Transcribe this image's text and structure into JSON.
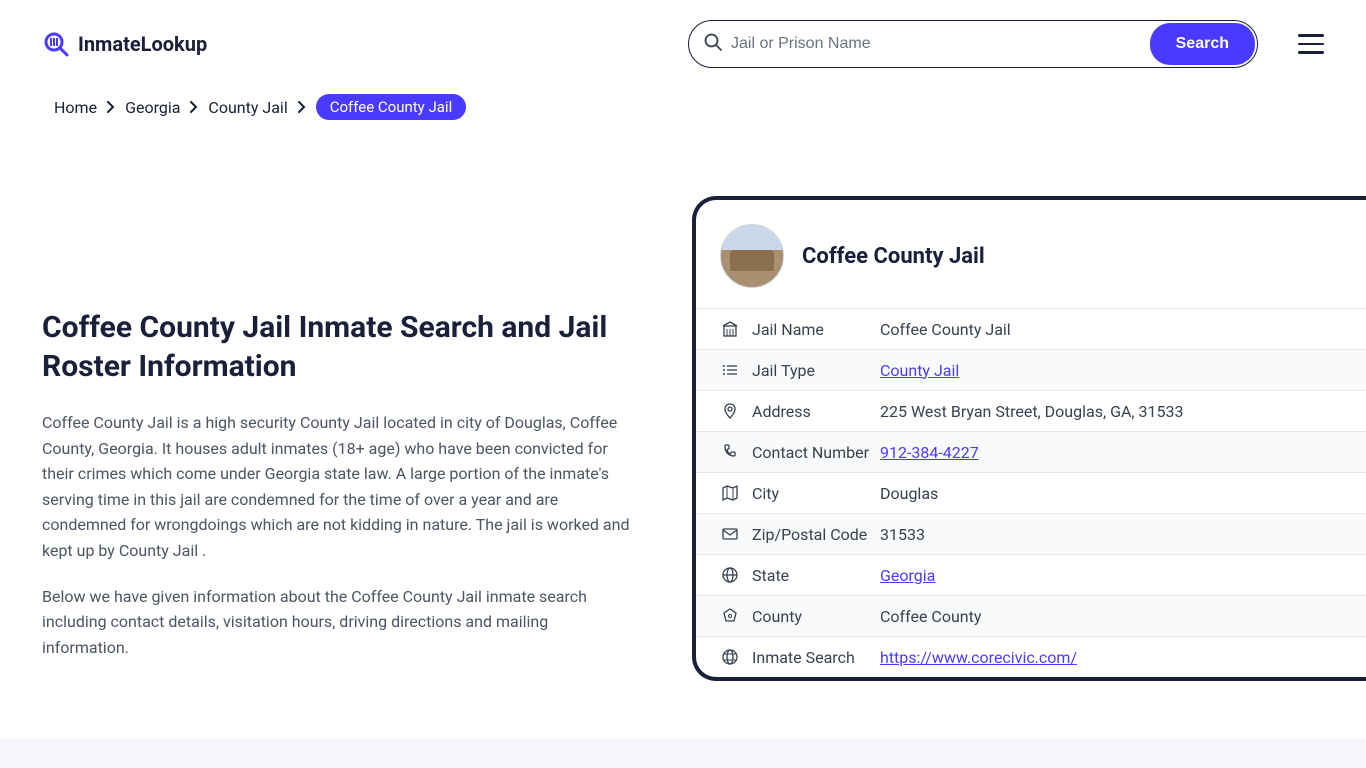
{
  "brand": {
    "name": "InmateLookup"
  },
  "search": {
    "placeholder": "Jail or Prison Name",
    "button_label": "Search"
  },
  "breadcrumb": {
    "items": [
      "Home",
      "Georgia",
      "County Jail"
    ],
    "current": "Coffee County Jail"
  },
  "page": {
    "title": "Coffee County Jail Inmate Search and Jail Roster Information",
    "description1": "Coffee County Jail is a high security County Jail located in city of Douglas, Coffee County, Georgia. It houses adult inmates (18+ age) who have been convicted for their crimes which come under Georgia state law. A large portion of the inmate's serving time in this jail are condemned for the time of over a year and are condemned for wrongdoings which are not kidding in nature. The jail is worked and kept up by County Jail .",
    "description2": "Below we have given information about the Coffee County Jail inmate search including contact details, visitation hours, driving directions and mailing information."
  },
  "card": {
    "title": "Coffee County Jail",
    "rows": [
      {
        "icon": "building",
        "label": "Jail Name",
        "value": "Coffee County Jail",
        "is_link": false
      },
      {
        "icon": "list",
        "label": "Jail Type",
        "value": "County Jail",
        "is_link": true
      },
      {
        "icon": "pin",
        "label": "Address",
        "value": "225 West Bryan Street, Douglas, GA, 31533",
        "is_link": false
      },
      {
        "icon": "phone",
        "label": "Contact Number",
        "value": "912-384-4227",
        "is_link": true
      },
      {
        "icon": "map",
        "label": "City",
        "value": "Douglas",
        "is_link": false
      },
      {
        "icon": "mail",
        "label": "Zip/Postal Code",
        "value": "31533",
        "is_link": false
      },
      {
        "icon": "globe",
        "label": "State",
        "value": "Georgia",
        "is_link": true
      },
      {
        "icon": "pentagon",
        "label": "County",
        "value": "Coffee County",
        "is_link": false
      },
      {
        "icon": "web",
        "label": "Inmate Search",
        "value": "https://www.corecivic.com/",
        "is_link": true
      }
    ]
  }
}
